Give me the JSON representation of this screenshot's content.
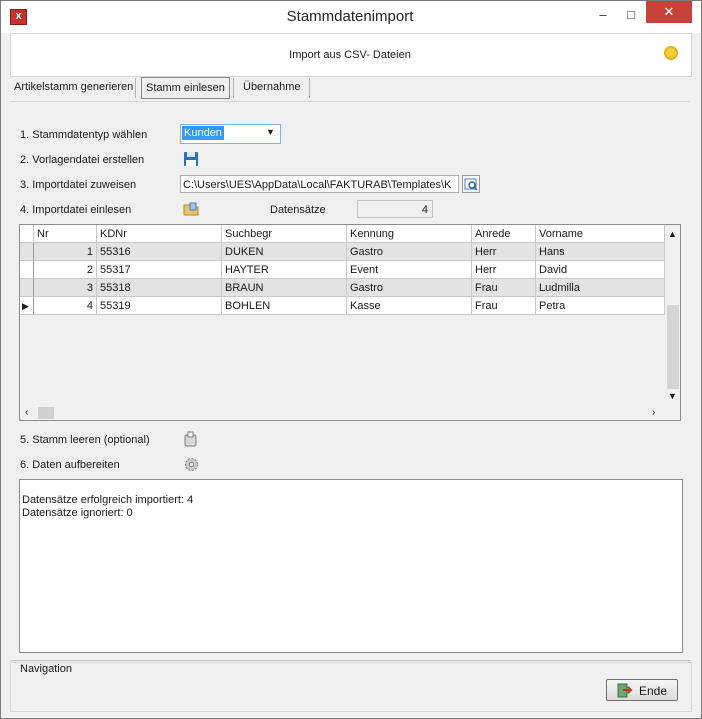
{
  "window": {
    "title": "Stammdatenimport",
    "close_glyph": "✕",
    "min_glyph": "–",
    "max_glyph": "□"
  },
  "header": {
    "text": "Import aus CSV- Dateien"
  },
  "tabs": [
    {
      "label": "Artikelstamm generieren"
    },
    {
      "label": "Stamm einlesen"
    },
    {
      "label": "Übernahme"
    }
  ],
  "steps": {
    "step1": "1. Stammdatentyp wählen",
    "step2": "2. Vorlagendatei erstellen",
    "step3": "3. Importdatei zuweisen",
    "step4": "4. Importdatei einlesen",
    "step5": "5. Stamm leeren (optional)",
    "step6": "6. Daten aufbereiten"
  },
  "type_select": {
    "value": "Kunden"
  },
  "import_path": {
    "value": "C:\\Users\\UES\\AppData\\Local\\FAKTURAB\\Templates\\K"
  },
  "records": {
    "label": "Datensätze",
    "count": "4"
  },
  "grid": {
    "columns": [
      "Nr",
      "KDNr",
      "Suchbegr",
      "Kennung",
      "Anrede",
      "Vorname"
    ],
    "rows": [
      [
        "1",
        "55316",
        "DUKEN",
        "Gastro",
        "Herr",
        "Hans"
      ],
      [
        "2",
        "55317",
        "HAYTER",
        "Event",
        "Herr",
        "David"
      ],
      [
        "3",
        "55318",
        "BRAUN",
        "Gastro",
        "Frau",
        "Ludmilla"
      ],
      [
        "4",
        "55319",
        "BOHLEN",
        "Kasse",
        "Frau",
        "Petra"
      ]
    ]
  },
  "log": {
    "line1": "Datensätze erfolgreich importiert: 4",
    "line2": "Datensätze ignoriert: 0"
  },
  "navigation": {
    "label": "Navigation",
    "ende_label": "Ende"
  }
}
